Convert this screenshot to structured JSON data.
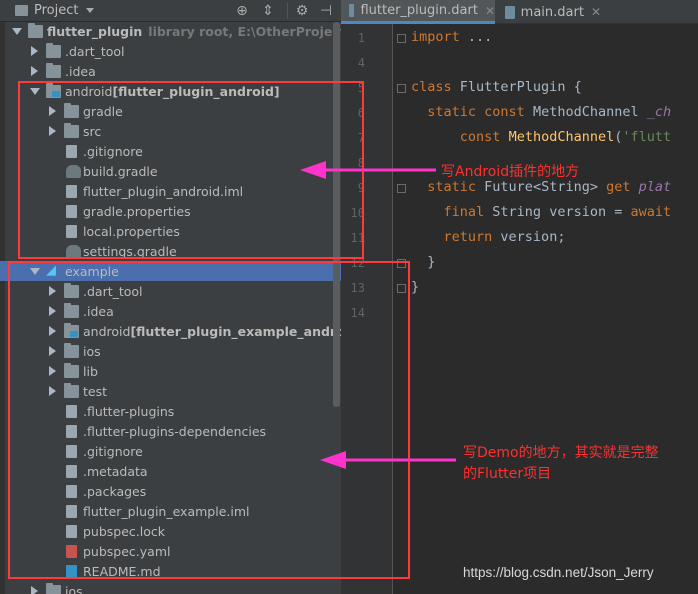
{
  "project_panel": {
    "title": "Project",
    "buttons": [
      "target-icon",
      "collapse-icon",
      "gear-icon",
      "hide-icon"
    ]
  },
  "tree": [
    {
      "depth": 0,
      "expanded": true,
      "icon": "folder",
      "name": "flutter_plugin",
      "hint": "library root,  E:\\OtherProject\\flutter_",
      "bold": true
    },
    {
      "depth": 1,
      "expanded": false,
      "icon": "folder",
      "name": ".dart_tool"
    },
    {
      "depth": 1,
      "expanded": false,
      "icon": "folder",
      "name": ".idea"
    },
    {
      "depth": 1,
      "expanded": true,
      "icon": "folder-module",
      "name": "android",
      "module": "[flutter_plugin_android]"
    },
    {
      "depth": 2,
      "expanded": false,
      "icon": "folder",
      "name": "gradle"
    },
    {
      "depth": 2,
      "expanded": false,
      "icon": "folder",
      "name": "src"
    },
    {
      "depth": 2,
      "icon": "file",
      "name": ".gitignore"
    },
    {
      "depth": 2,
      "icon": "gradle",
      "name": "build.gradle"
    },
    {
      "depth": 2,
      "icon": "iml",
      "name": "flutter_plugin_android.iml"
    },
    {
      "depth": 2,
      "icon": "file",
      "name": "gradle.properties"
    },
    {
      "depth": 2,
      "icon": "file",
      "name": "local.properties"
    },
    {
      "depth": 2,
      "icon": "gradle",
      "name": "settings.gradle"
    },
    {
      "depth": 1,
      "expanded": true,
      "icon": "flutter",
      "name": "example",
      "selected": true
    },
    {
      "depth": 2,
      "expanded": false,
      "icon": "folder",
      "name": ".dart_tool"
    },
    {
      "depth": 2,
      "expanded": false,
      "icon": "folder",
      "name": ".idea"
    },
    {
      "depth": 2,
      "expanded": false,
      "icon": "folder-module",
      "name": "android",
      "module": "[flutter_plugin_example_android]"
    },
    {
      "depth": 2,
      "expanded": false,
      "icon": "folder",
      "name": "ios"
    },
    {
      "depth": 2,
      "expanded": false,
      "icon": "folder",
      "name": "lib"
    },
    {
      "depth": 2,
      "expanded": false,
      "icon": "folder",
      "name": "test"
    },
    {
      "depth": 2,
      "icon": "file",
      "name": ".flutter-plugins"
    },
    {
      "depth": 2,
      "icon": "file",
      "name": ".flutter-plugins-dependencies"
    },
    {
      "depth": 2,
      "icon": "file",
      "name": ".gitignore"
    },
    {
      "depth": 2,
      "icon": "file",
      "name": ".metadata"
    },
    {
      "depth": 2,
      "icon": "file",
      "name": ".packages"
    },
    {
      "depth": 2,
      "icon": "iml",
      "name": "flutter_plugin_example.iml"
    },
    {
      "depth": 2,
      "icon": "file",
      "name": "pubspec.lock"
    },
    {
      "depth": 2,
      "icon": "yaml",
      "name": "pubspec.yaml"
    },
    {
      "depth": 2,
      "icon": "md",
      "name": "README.md"
    },
    {
      "depth": 1,
      "expanded": false,
      "icon": "folder",
      "name": "ios"
    }
  ],
  "editor": {
    "tabs": [
      {
        "label": "flutter_plugin.dart",
        "active": true
      },
      {
        "label": "main.dart",
        "active": false
      }
    ],
    "lines": [
      {
        "n": "1",
        "tokens": [
          [
            "kw",
            "import"
          ],
          [
            "plain",
            " ..."
          ]
        ]
      },
      {
        "n": "4",
        "tokens": []
      },
      {
        "n": "5",
        "tokens": [
          [
            "kw",
            "class "
          ],
          [
            "cls",
            "FlutterPlugin {"
          ]
        ]
      },
      {
        "n": "6",
        "tokens": [
          [
            "plain",
            "  "
          ],
          [
            "kw",
            "static const "
          ],
          [
            "cls",
            "MethodChannel "
          ],
          [
            "it",
            "_ch"
          ]
        ]
      },
      {
        "n": "7",
        "tokens": [
          [
            "plain",
            "      "
          ],
          [
            "kw",
            "const "
          ],
          [
            "fn",
            "MethodChannel"
          ],
          [
            "plain",
            "("
          ],
          [
            "str",
            "'flutt"
          ]
        ]
      },
      {
        "n": "8",
        "tokens": []
      },
      {
        "n": "9",
        "tokens": [
          [
            "plain",
            "  "
          ],
          [
            "kw",
            "static "
          ],
          [
            "cls",
            "Future<String> "
          ],
          [
            "kw",
            "get "
          ],
          [
            "it",
            "plat"
          ]
        ]
      },
      {
        "n": "10",
        "tokens": [
          [
            "plain",
            "    "
          ],
          [
            "kw",
            "final "
          ],
          [
            "cls",
            "String version = "
          ],
          [
            "kw",
            "await"
          ]
        ]
      },
      {
        "n": "11",
        "tokens": [
          [
            "plain",
            "    "
          ],
          [
            "kw",
            "return "
          ],
          [
            "cls",
            "version;"
          ]
        ]
      },
      {
        "n": "12",
        "tokens": [
          [
            "plain",
            "  }"
          ]
        ]
      },
      {
        "n": "13",
        "tokens": [
          [
            "plain",
            "}"
          ]
        ]
      },
      {
        "n": "14",
        "tokens": []
      }
    ]
  },
  "annotations": {
    "android_note": "写Android插件的地方",
    "demo_note_line1": "写Demo的地方，其实就是完整",
    "demo_note_line2": "的Flutter项目",
    "color": "#ff3a3a",
    "arrow_color": "#ff33cc"
  },
  "watermark": "https://blog.csdn.net/Json_Jerry"
}
